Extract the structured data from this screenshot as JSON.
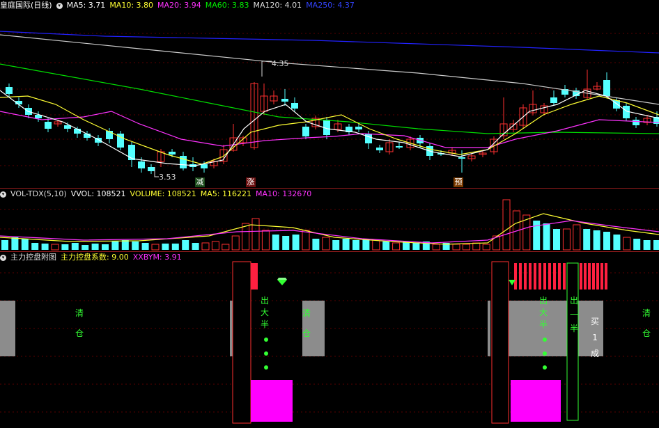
{
  "colors": {
    "up": "#ff3030",
    "down": "#54ffff",
    "ma5": "#ffffff",
    "ma10": "#ffff33",
    "ma20": "#ff33ff",
    "ma60": "#00dd00",
    "ma120": "#cccccc",
    "ma250": "#2222ff",
    "gray": "#8c8c8c",
    "magenta": "#ff00ff",
    "green_text": "#33ff33"
  },
  "main": {
    "title": "皇庭国际(日线)",
    "ma5": "MA5: 3.71",
    "ma10": "MA10: 3.80",
    "ma20": "MA20: 3.94",
    "ma60": "MA60: 3.83",
    "ma120": "MA120: 4.01",
    "ma250": "MA250: 4.37",
    "high_label": "4.35",
    "low_label": "3.53",
    "marker1": "减",
    "marker2": "涨",
    "marker3": "预"
  },
  "vol": {
    "title": "VOL-TDX(5,10)",
    "vvol": "VVOL: 108521",
    "volume": "VOLUME: 108521",
    "ma5": "MA5: 116221",
    "ma10": "MA10: 132670"
  },
  "ind": {
    "title": "主力控盘附图",
    "coef": "主力控盘系数: 9.00",
    "xxbym": "XXBYM: 3.91",
    "qing1": "清",
    "cang1": "仓",
    "qing2": "清",
    "cang2": "仓",
    "qing3": "清",
    "cang3": "仓",
    "chu1": "出",
    "da1": "大",
    "ban1": "半",
    "chu2": "出",
    "da2": "大",
    "ban2": "半",
    "chu3": "出",
    "yi3": "一",
    "ban3": "半",
    "mai": "买",
    "yi": "1",
    "cheng": "成"
  }
}
